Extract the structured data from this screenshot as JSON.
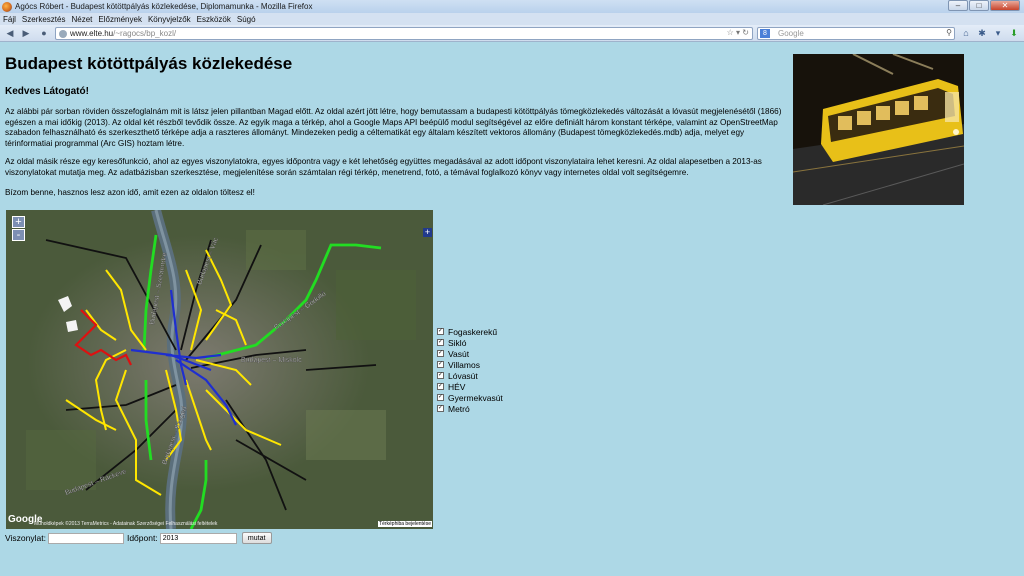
{
  "window": {
    "title": "Agócs Róbert - Budapest kötöttpályás közlekedése, Diplomamunka - Mozilla Firefox",
    "controls": [
      "–",
      "□",
      "✕"
    ]
  },
  "menu": [
    "Fájl",
    "Szerkesztés",
    "Nézet",
    "Előzmények",
    "Könyvjelzők",
    "Eszközök",
    "Súgó"
  ],
  "navbar": {
    "url_host": "www.elte.hu",
    "url_path": "/~ragocs/bp_kozl/",
    "search_placeholder": "Google",
    "search_engine_letter": "8"
  },
  "page": {
    "title": "Budapest kötöttpályás közlekedése",
    "greeting": "Kedves Látogató!",
    "paragraphs": [
      "Az alábbi pár sorban röviden összefoglalnám mit is látsz jelen pillantban Magad előtt. Az oldal azért jött létre, hogy bemutassam a budapesti kötöttpályás tömegközlekedés változását a lóvasút megjelenésétől (1866) egészen a mai időkig (2013). Az oldal két részből tevődik össze. Az egyik maga a térkép, ahol a Google Maps API beépülő modul segítségével az előre definiált három konstant térképe, valamint az OpenStreetMap szabadon felhasználható és szerkeszthető térképe adja a raszteres állományt. Mindezeken pedig a céltematikát egy általam készített vektoros állomány (Budapest tömegközlekedés.mdb) adja, melyet egy térinformatiai programmal (Arc GIS) hoztam létre.",
      "Az oldal másik része egy keresőfunkció, ahol az egyes viszonylatokra, egyes időpontra vagy e két lehetőség együttes megadásával az adott időpont viszonylataira lehet keresni. Az oldal alapesetben a 2013-as viszonylatokat mutatja meg. Az adatbázisban szerkesztése, megjelenítése során számtalan régi térkép, menetrend, fotó, a témával foglalkozó könyv vagy internetes oldal volt segítségemre.",
      "Bízom benne, hasznos lesz azon idő, amit ezen az oldalon töltesz el!"
    ]
  },
  "map": {
    "zoom_in": "+",
    "zoom_out": "-",
    "layer_switch": "+",
    "logo": "Google",
    "attribution": "Műholdképek ©2013 TerraMetrics - Adatainak Szerzőségei Felhasználási feltételek",
    "report": "Térképhiba bejelentése",
    "road_labels": [
      "Budapest – Miskolc",
      "Budapest – Vác",
      "Budapest – Szeged",
      "Budapest – Gödöllő",
      "Budapest – Szentendre",
      "Budapest – Ráckeve"
    ],
    "line_colors": {
      "green": "#22dd22",
      "yellow": "#ffe600",
      "blue": "#1f2fcf",
      "red": "#dd1111",
      "black": "#111111"
    }
  },
  "layers": [
    {
      "label": "Fogaskerekű",
      "checked": true
    },
    {
      "label": "Sikló",
      "checked": true
    },
    {
      "label": "Vasút",
      "checked": true
    },
    {
      "label": "Villamos",
      "checked": true
    },
    {
      "label": "Lóvasút",
      "checked": true
    },
    {
      "label": "HÉV",
      "checked": true
    },
    {
      "label": "Gyermekvasút",
      "checked": true
    },
    {
      "label": "Metró",
      "checked": true
    }
  ],
  "form": {
    "route_label": "Viszonylat:",
    "route_value": "",
    "time_label": "Időpont:",
    "time_value": "2013",
    "submit_label": "mutat"
  }
}
